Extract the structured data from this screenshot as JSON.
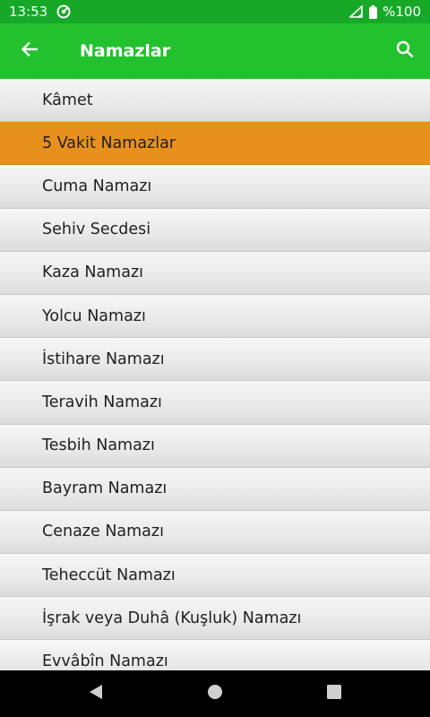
{
  "status_bar": {
    "time": "13:53",
    "battery": "%100"
  },
  "app_bar": {
    "title": "Namazlar"
  },
  "list": {
    "selected_index": 1,
    "items": [
      {
        "label": "Kâmet"
      },
      {
        "label": "5 Vakit Namazlar"
      },
      {
        "label": "Cuma Namazı"
      },
      {
        "label": "Sehiv Secdesi"
      },
      {
        "label": "Kaza Namazı"
      },
      {
        "label": "Yolcu Namazı"
      },
      {
        "label": "İstihare Namazı"
      },
      {
        "label": "Teravih Namazı"
      },
      {
        "label": "Tesbih Namazı"
      },
      {
        "label": "Bayram Namazı"
      },
      {
        "label": "Cenaze Namazı"
      },
      {
        "label": "Teheccüt Namazı"
      },
      {
        "label": "İşrak veya Duhâ (Kuşluk) Namazı"
      },
      {
        "label": "Evvâbîn Namazı"
      }
    ]
  },
  "colors": {
    "status_bar": "#17a828",
    "app_bar": "#22c12e",
    "selected_item": "#e8901e"
  }
}
